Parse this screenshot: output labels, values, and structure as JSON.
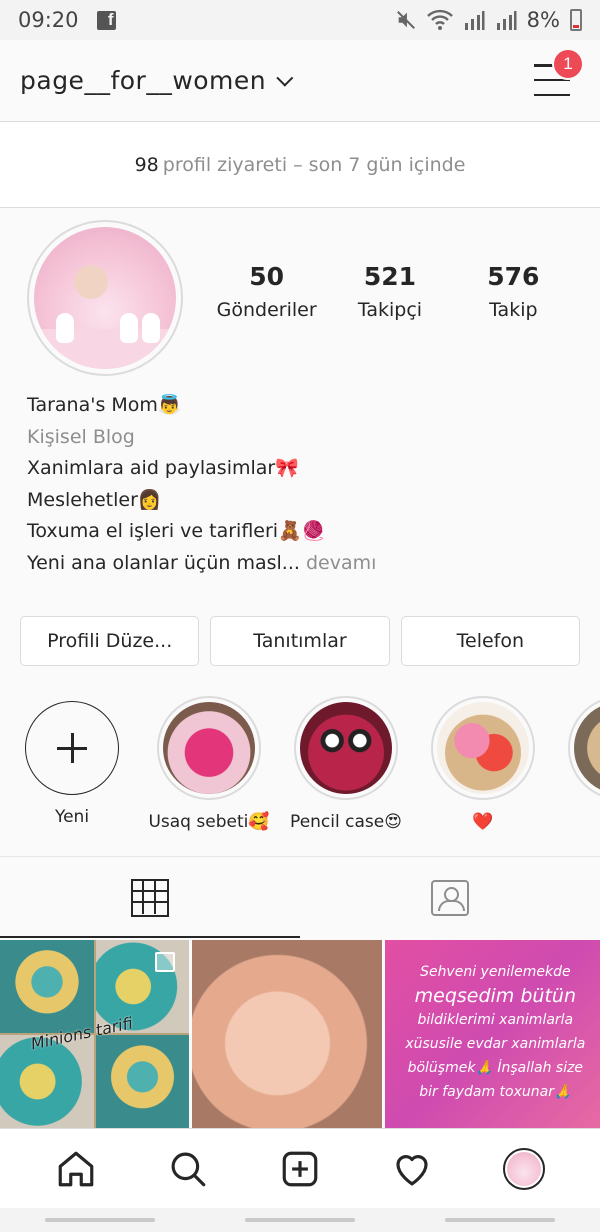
{
  "status_bar": {
    "time": "09:20",
    "battery": "8%"
  },
  "header": {
    "username": "page__for__women",
    "notification_count": "1"
  },
  "visits": {
    "count": "98",
    "text": "profil ziyareti – son 7 gün içinde"
  },
  "stats": [
    {
      "value": "50",
      "label": "Gönderiler"
    },
    {
      "value": "521",
      "label": "Takipçi"
    },
    {
      "value": "576",
      "label": "Takip"
    }
  ],
  "bio": {
    "name": "Tarana's Mom👼",
    "category": "Kişisel Blog",
    "lines": [
      "Xanimlara aid paylasimlar🎀",
      "Meslehetler👩",
      "Toxuma el işleri ve tarifleri🧸🧶"
    ],
    "truncated": "Yeni ana olanlar üçün masl...",
    "more": "devamı"
  },
  "buttons": {
    "edit_profile": "Profili Düze...",
    "promotions": "Tanıtımlar",
    "phone": "Telefon"
  },
  "highlights": [
    {
      "label": "Yeni"
    },
    {
      "label": "Usaq sebeti🥰"
    },
    {
      "label": "Pencil case😍"
    },
    {
      "label": "❤️"
    },
    {
      "label": "🧶"
    }
  ],
  "posts": {
    "post1_caption": "Minions tarifi",
    "post3_line1": "Sehveni yenilemekde",
    "post3_line2": "meqsedim bütün",
    "post3_line3": "bildiklerimi xanimlarla",
    "post3_line4": "xüsusile evdar xanimlarla",
    "post3_line5": "bölüşmek🙏 İnşallah size",
    "post3_line6": "bir faydam toxunar🙏"
  },
  "colors": {
    "accent": "#ed4956",
    "text": "#262626",
    "muted": "#8e8e8e",
    "border": "#dbdbdb"
  }
}
